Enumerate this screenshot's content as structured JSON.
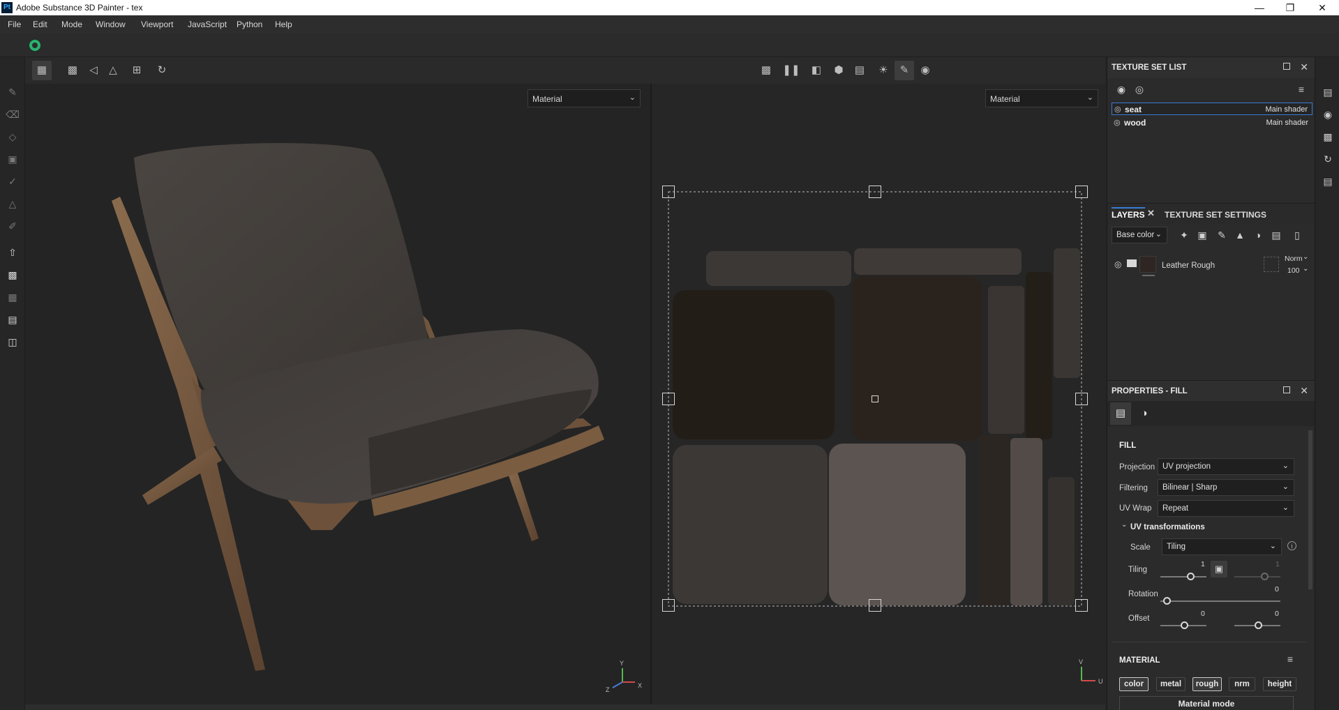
{
  "window": {
    "app_icon": "Pt",
    "title": "Adobe Substance 3D Painter - tex"
  },
  "menu": [
    "File",
    "Edit",
    "Mode",
    "Window",
    "Viewport",
    "JavaScript",
    "Python",
    "Help"
  ],
  "viewport3d": {
    "mode": "Material"
  },
  "viewport2d": {
    "mode": "Material"
  },
  "texture_set_list": {
    "title": "TEXTURE SET LIST",
    "items": [
      {
        "name": "seat",
        "shader": "Main shader",
        "selected": true
      },
      {
        "name": "wood",
        "shader": "Main shader",
        "selected": false
      }
    ]
  },
  "layers": {
    "tab_label": "LAYERS",
    "tab2_label": "TEXTURE SET SETTINGS",
    "channel": "Base color",
    "items": [
      {
        "name": "Leather Rough",
        "blend": "Norm",
        "opacity": "100"
      }
    ]
  },
  "properties": {
    "title": "PROPERTIES - FILL",
    "section_fill": "FILL",
    "projection_label": "Projection",
    "projection": "UV projection",
    "filtering_label": "Filtering",
    "filtering": "Bilinear | Sharp",
    "uvwrap_label": "UV Wrap",
    "uvwrap": "Repeat",
    "uvtrans_label": "UV transformations",
    "scale_label": "Scale",
    "scale": "Tiling",
    "tiling_label": "Tiling",
    "tiling_u": "1",
    "tiling_v": "1",
    "rotation_label": "Rotation",
    "rotation": "0",
    "offset_label": "Offset",
    "offset_u": "0",
    "offset_v": "0",
    "section_material": "MATERIAL",
    "channels": [
      {
        "label": "color",
        "on": true
      },
      {
        "label": "metal",
        "on": false
      },
      {
        "label": "rough",
        "on": true
      },
      {
        "label": "nrm",
        "on": false
      },
      {
        "label": "height",
        "on": false
      }
    ],
    "material_mode": "Material mode"
  },
  "axis_labels": {
    "y": "Y",
    "x": "X",
    "z": "Z",
    "u": "U",
    "v": "V"
  },
  "colors": {
    "selection": "#3a7bd5",
    "app_green": "#27b36e"
  }
}
